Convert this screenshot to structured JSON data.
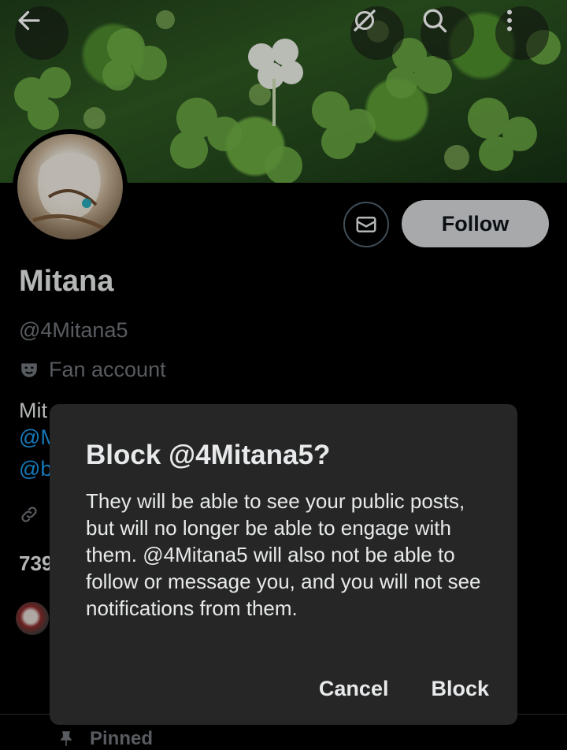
{
  "header": {
    "back_icon": "arrow-left-icon",
    "grok_icon": "grok-icon",
    "search_icon": "search-icon",
    "more_icon": "more-vertical-icon"
  },
  "profile": {
    "display_name": "Mitana",
    "handle": "@4Mitana5",
    "category": "Fan account",
    "bio_line1_start": "Mit",
    "bio_line2_start": "@M",
    "bio_line3_start": "@b",
    "stat_partial": "739",
    "follow_label": "Follow"
  },
  "tabs": {
    "pinned_label": "Pinned"
  },
  "dialog": {
    "title": "Block @4Mitana5?",
    "body": "They will be able to see your public posts, but will no longer be able to engage with them. @4Mitana5 will also not be able to follow or message you, and you will not see notifications from them.",
    "cancel_label": "Cancel",
    "confirm_label": "Block"
  },
  "colors": {
    "link": "#1d9bf0",
    "secondary_text": "#71767b",
    "dialog_bg": "#262626"
  }
}
